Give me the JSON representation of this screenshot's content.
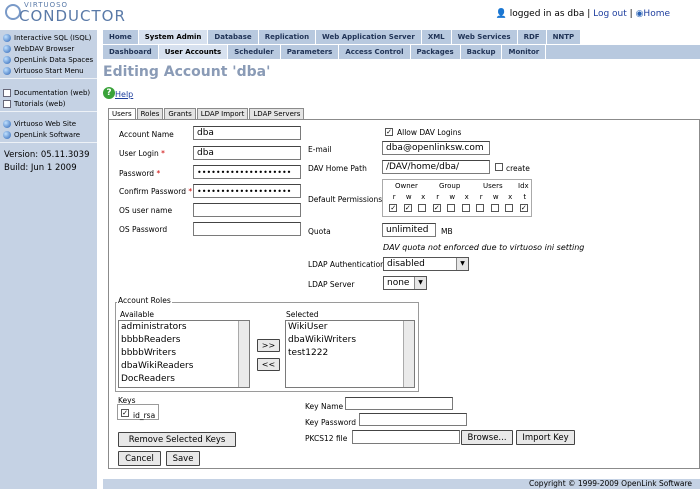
{
  "brand": {
    "small": "VIRTUOSO",
    "big": "CONDUCTOR"
  },
  "user": {
    "logged_in": "logged in as dba",
    "log_out": "Log out",
    "home": "Home"
  },
  "sidebar": {
    "group1": [
      "Interactive SQL (ISQL)",
      "WebDAV Browser",
      "OpenLink Data Spaces",
      "Virtuoso Start Menu"
    ],
    "group2": [
      "Documentation (web)",
      "Tutorials (web)"
    ],
    "group3": [
      "Virtuoso Web Site",
      "OpenLink Software"
    ],
    "version": "Version: 05.11.3039",
    "build": "Build: Jun 1 2009"
  },
  "tabs1": [
    "Home",
    "System Admin",
    "Database",
    "Replication",
    "Web Application Server",
    "XML",
    "Web Services",
    "RDF",
    "NNTP"
  ],
  "tabs2": [
    "Dashboard",
    "User Accounts",
    "Scheduler",
    "Parameters",
    "Access Control",
    "Packages",
    "Backup",
    "Monitor"
  ],
  "page_title": "Editing Account 'dba'",
  "help": "Help",
  "subtabs": [
    "Users",
    "Roles",
    "Grants",
    "LDAP Import",
    "LDAP Servers"
  ],
  "form": {
    "account_name_label": "Account Name",
    "account_name": "dba",
    "user_login_label": "User Login",
    "user_login": "dba",
    "password_label": "Password",
    "password": "••••••••••••••••••••",
    "confirm_label": "Confirm Password",
    "confirm": "••••••••••••••••••••",
    "os_user_label": "OS user name",
    "os_user": "",
    "os_password_label": "OS Password",
    "os_password": "",
    "allow_dav": "Allow DAV Logins",
    "email_label": "E-mail",
    "email": "dba@openlinksw.com",
    "dav_home_label": "DAV Home Path",
    "dav_home": "/DAV/home/dba/",
    "create": "create",
    "default_perm_label": "Default Permissions",
    "perm_groups": [
      "Owner",
      "Group",
      "Users",
      "Idx"
    ],
    "perm_letters": [
      "r",
      "w",
      "x",
      "r",
      "w",
      "x",
      "r",
      "w",
      "x",
      "t"
    ],
    "quota_label": "Quota",
    "quota": "unlimited",
    "quota_unit": "MB",
    "quota_note": "DAV quota not enforced due to virtuoso ini setting",
    "ldap_auth_label": "LDAP Authentication",
    "ldap_auth": "disabled",
    "ldap_server_label": "LDAP Server",
    "ldap_server": "none"
  },
  "roles": {
    "legend": "Account Roles",
    "available_label": "Available",
    "selected_label": "Selected",
    "available": [
      "administrators",
      "bbbbReaders",
      "bbbbWriters",
      "dbaWikiReaders",
      "DocReaders"
    ],
    "selected": [
      "WikiUser",
      "dbaWikiWriters",
      "test1222"
    ],
    "add": ">>",
    "remove": "<<"
  },
  "keys": {
    "legend": "Keys",
    "item": "id_rsa",
    "key_name_label": "Key Name",
    "key_password_label": "Key Password",
    "pkcs_label": "PKCS12 file",
    "browse": "Browse...",
    "import": "Import Key",
    "remove_selected": "Remove Selected Keys"
  },
  "buttons": {
    "cancel": "Cancel",
    "save": "Save"
  },
  "footer": "Copyright © 1999-2009 OpenLink Software"
}
